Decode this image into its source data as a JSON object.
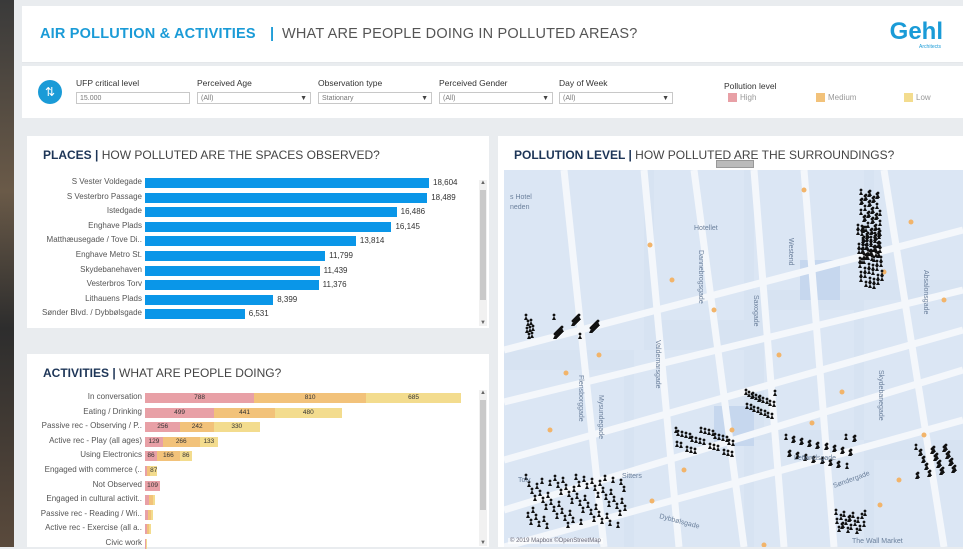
{
  "header": {
    "title_main": "AIR POLLUTION & ACTIVITIES",
    "title_sep": "|",
    "title_sub": "WHAT ARE PEOPLE DOING IN POLLUTED AREAS?",
    "logo": "Gehl",
    "logo_sub": "Architects"
  },
  "filters": {
    "icon": "sliders-icon",
    "ufp": {
      "label": "UFP critical level",
      "value": "15.000"
    },
    "age": {
      "label": "Perceived Age",
      "value": "(All)"
    },
    "obs": {
      "label": "Observation type",
      "value": "Stationary"
    },
    "gender": {
      "label": "Perceived Gender",
      "value": "(All)"
    },
    "day": {
      "label": "Day of Week",
      "value": "(All)"
    },
    "pollution": {
      "label": "Pollution level",
      "items": [
        {
          "label": "High",
          "color": "#e8a0a6"
        },
        {
          "label": "Medium",
          "color": "#f2c27a"
        },
        {
          "label": "Low",
          "color": "#f3dc8e"
        }
      ]
    }
  },
  "places": {
    "title_bold": "PLACES |",
    "title_rest": " HOW POLLUTED ARE THE SPACES OBSERVED?",
    "chart_data": {
      "type": "bar",
      "orientation": "horizontal",
      "categories": [
        "S Vester Voldegade",
        "S Vesterbro Passage",
        "Istedgade",
        "Enghave Plads",
        "Matthæusegade / Tove Di..",
        "Enghave Metro St.",
        "Skydebanehaven",
        "Vesterbros Torv",
        "Lithauens Plads",
        "Sønder Blvd. / Dybbølsgade"
      ],
      "values": [
        18604,
        18489,
        16486,
        16145,
        13814,
        11799,
        11439,
        11376,
        8399,
        6531
      ],
      "value_labels": [
        "18,604",
        "18,489",
        "16,486",
        "16,145",
        "13,814",
        "11,799",
        "11,439",
        "11,376",
        "8,399",
        "6,531"
      ],
      "color": "#0a96e8"
    }
  },
  "activities": {
    "title_bold": "ACTIVITIES |",
    "title_rest": " WHAT ARE PEOPLE DOING?",
    "chart_data": {
      "type": "bar",
      "orientation": "horizontal",
      "stacked": true,
      "categories": [
        "In conversation",
        "Eating / Drinking",
        "Passive rec - Observing / P..",
        "Active rec - Play (all ages)",
        "Using Electronics",
        "Engaged with commerce (..",
        "Not Observed",
        "Engaged in cultural activit..",
        "Passive rec - Reading / Wri..",
        "Active rec - Exercise (all a..",
        "Civic work"
      ],
      "series": [
        {
          "name": "High",
          "color": "#e8a0a6",
          "values": [
            788,
            499,
            256,
            129,
            86,
            17,
            109,
            30,
            20,
            15,
            5
          ]
        },
        {
          "name": "Medium",
          "color": "#f2c27a",
          "values": [
            810,
            441,
            242,
            266,
            166,
            20,
            0,
            25,
            20,
            15,
            5
          ]
        },
        {
          "name": "Low",
          "color": "#f3dc8e",
          "values": [
            685,
            480,
            330,
            133,
            86,
            50,
            0,
            20,
            20,
            15,
            5
          ]
        }
      ],
      "segment_labels": [
        [
          "788",
          "810",
          "685"
        ],
        [
          "499",
          "441",
          "480"
        ],
        [
          "256",
          "242",
          "330"
        ],
        [
          "129",
          "266",
          "133"
        ],
        [
          "86",
          "166",
          "86"
        ],
        [
          "",
          "",
          "87"
        ],
        [
          "109",
          "",
          ""
        ],
        [
          "",
          "",
          ""
        ],
        [
          "",
          "",
          ""
        ],
        [
          "",
          "",
          ""
        ],
        [
          "",
          "",
          ""
        ]
      ]
    }
  },
  "pollution_map": {
    "title_bold": "POLLUTION LEVEL |",
    "title_rest": " HOW POLLUTED ARE THE SURROUNDINGS?",
    "attribution": "© 2019 Mapbox ©OpenStreetMap",
    "street_labels": [
      "Hotellet",
      "Westend",
      "Dannebrogsgade",
      "Saxogade",
      "Valdemarsgade",
      "Flensborggade",
      "Mysundegade",
      "Letlandsgade",
      "Skydebanegade",
      "Absalonsgade",
      "Søndergade",
      "Dybbølsgade",
      "The Wall Market",
      "Tolv",
      "Sitters",
      "s Hotel",
      "neden"
    ]
  }
}
